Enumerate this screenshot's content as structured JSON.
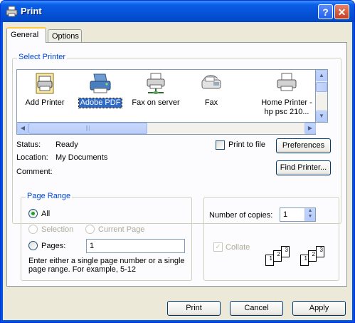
{
  "window": {
    "title": "Print",
    "help_glyph": "?",
    "close_glyph": "✕"
  },
  "tabs": [
    {
      "label": "General",
      "active": true
    },
    {
      "label": "Options",
      "active": false
    }
  ],
  "select_printer": {
    "legend": "Select Printer",
    "printers": [
      {
        "label": "Add Printer",
        "icon": "add-printer-icon",
        "selected": false
      },
      {
        "label": "Adobe PDF",
        "icon": "printer-icon",
        "selected": true
      },
      {
        "label": "Fax on server",
        "icon": "network-printer-icon",
        "selected": false
      },
      {
        "label": "Fax",
        "icon": "fax-icon",
        "selected": false
      },
      {
        "label": "Home Printer - hp psc 210...",
        "icon": "printer-icon",
        "selected": false
      }
    ],
    "status_label": "Status:",
    "status_value": "Ready",
    "location_label": "Location:",
    "location_value": "My Documents",
    "comment_label": "Comment:",
    "print_to_file_label": "Print to file",
    "preferences_button": "Preferences",
    "find_printer_button": "Find Printer..."
  },
  "page_range": {
    "legend": "Page Range",
    "all_label": "All",
    "selection_label": "Selection",
    "current_page_label": "Current Page",
    "pages_label": "Pages:",
    "pages_value": "1",
    "hint": "Enter either a single page number or a single page range.  For example, 5-12",
    "selected_option": "All"
  },
  "copies": {
    "number_label": "Number of copies:",
    "number_value": "1",
    "collate_label": "Collate",
    "collate_checked": true,
    "collate_enabled": false,
    "collate_pages": [
      "1",
      "2",
      "3",
      "1",
      "2",
      "3"
    ]
  },
  "footer": {
    "print_button": "Print",
    "cancel_button": "Cancel",
    "apply_button": "Apply"
  },
  "colors": {
    "title_bar": "#0054e3",
    "dialog_bg": "#ece9d8",
    "selection": "#316ac5",
    "group_legend": "#0046d5"
  }
}
